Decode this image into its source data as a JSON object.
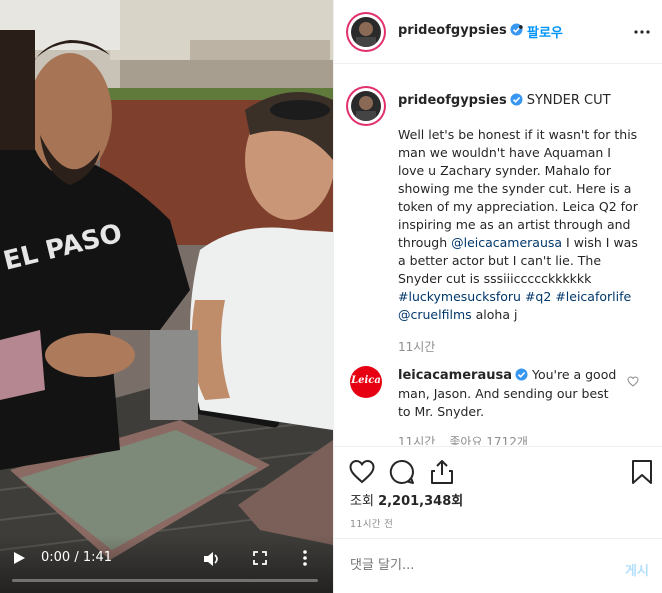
{
  "post": {
    "username": "prideofgypsies",
    "follow_label": "팔로우",
    "separator": "•"
  },
  "caption": {
    "username": "prideofgypsies",
    "title": "SYNDER CUT",
    "lines": [
      "Well let's be honest if it wasn't for this",
      "man we wouldn't have Aquaman I",
      "love u Zachary synder. Mahalo for",
      "showing me the synder cut. Here is a",
      "token of my appreciation. Leica Q2 for",
      "inspiring me as an artist through and"
    ],
    "line7_pre": "through ",
    "line7_link": "@leicacamerausa",
    "line7_post": " I wish I was",
    "line8": "a better actor but I can't lie. The",
    "line9": "Snyder cut is sssiiiccccckkkkkk",
    "hashtag1": "#luckymesucksforu",
    "hashtag2": "#q2",
    "hashtag3": "#leicaforlife",
    "mention2": "@cruelfilms",
    "closing": " aloha j",
    "time": "11시간"
  },
  "comment": {
    "avatar_text": "Leica",
    "username": "leicacamerausa",
    "line1": " You're a good",
    "line2": "man, Jason. And sending our best",
    "line3": "to Mr. Snyder.",
    "time": "11시간",
    "likes": "좋아요 1712개"
  },
  "stats": {
    "views_label": "조회 ",
    "views_count": "2,201,348회",
    "posted": "11시간 전"
  },
  "add_comment": {
    "placeholder": "댓글 달기...",
    "post_label": "게시"
  },
  "video": {
    "time_display": "0:00 / 1:41",
    "progress": 0.0
  },
  "icons": {
    "header_more": "more-horizontal-icon",
    "like": "heart-icon",
    "comment": "comment-icon",
    "share": "share-icon",
    "save": "bookmark-icon"
  },
  "colors": {
    "accent": "#0095f6",
    "link": "#00376b",
    "muted": "#8e8e8e",
    "verified": "#3897f0",
    "leica": "#e60012"
  }
}
